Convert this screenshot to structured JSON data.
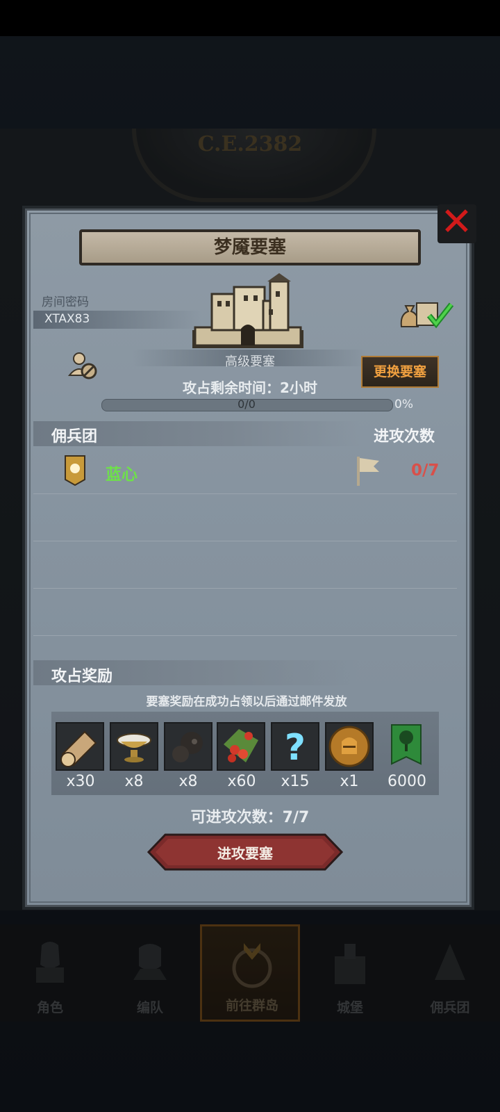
{
  "backdrop": {
    "era_text": "C.E.2382",
    "nav_items": [
      {
        "label": "角色",
        "icon": "knight-helmet-icon"
      },
      {
        "label": "编队",
        "icon": "squad-helmet-icon"
      },
      {
        "label": "前往群岛",
        "icon": "compass-icon",
        "active": true
      },
      {
        "label": "城堡",
        "icon": "castle-icon"
      },
      {
        "label": "佣兵团",
        "icon": "mercenary-icon"
      }
    ]
  },
  "dialog": {
    "title": "梦魇要塞",
    "close_icon": "close-x-icon",
    "room_label": "房间密码",
    "room_code": "XTAX83",
    "castle_caption": "高级要塞",
    "change_button": "更换要塞",
    "timer_text": "攻占剩余时间：2小时",
    "progress": {
      "text": "0/0",
      "percent": "0%",
      "fraction": 0
    },
    "mercenary_section": {
      "title": "佣兵团",
      "count_title": "进攻次数",
      "row": {
        "name": "蓝心",
        "count": "0/7"
      }
    },
    "reward_section": {
      "title": "攻占奖励",
      "note": "要塞奖励在成功占领以后通过邮件发放",
      "rewards": [
        {
          "icon": "log-icon",
          "qty": "x30"
        },
        {
          "icon": "bowl-icon",
          "qty": "x8"
        },
        {
          "icon": "ore-icon",
          "qty": "x8"
        },
        {
          "icon": "berries-icon",
          "qty": "x60"
        },
        {
          "icon": "mystery-question-icon",
          "qty": "x15"
        },
        {
          "icon": "knight-coin-icon",
          "qty": "x1"
        },
        {
          "icon": "tree-banner-icon",
          "qty": "6000"
        }
      ]
    },
    "attempts_text": "可进攻次数：7/7",
    "attack_button": "进攻要塞"
  },
  "colors": {
    "merc_name": "#6ee04a",
    "merc_count": "#d8504a",
    "change_button_text": "#f0a040",
    "close": "#d21a1a"
  }
}
